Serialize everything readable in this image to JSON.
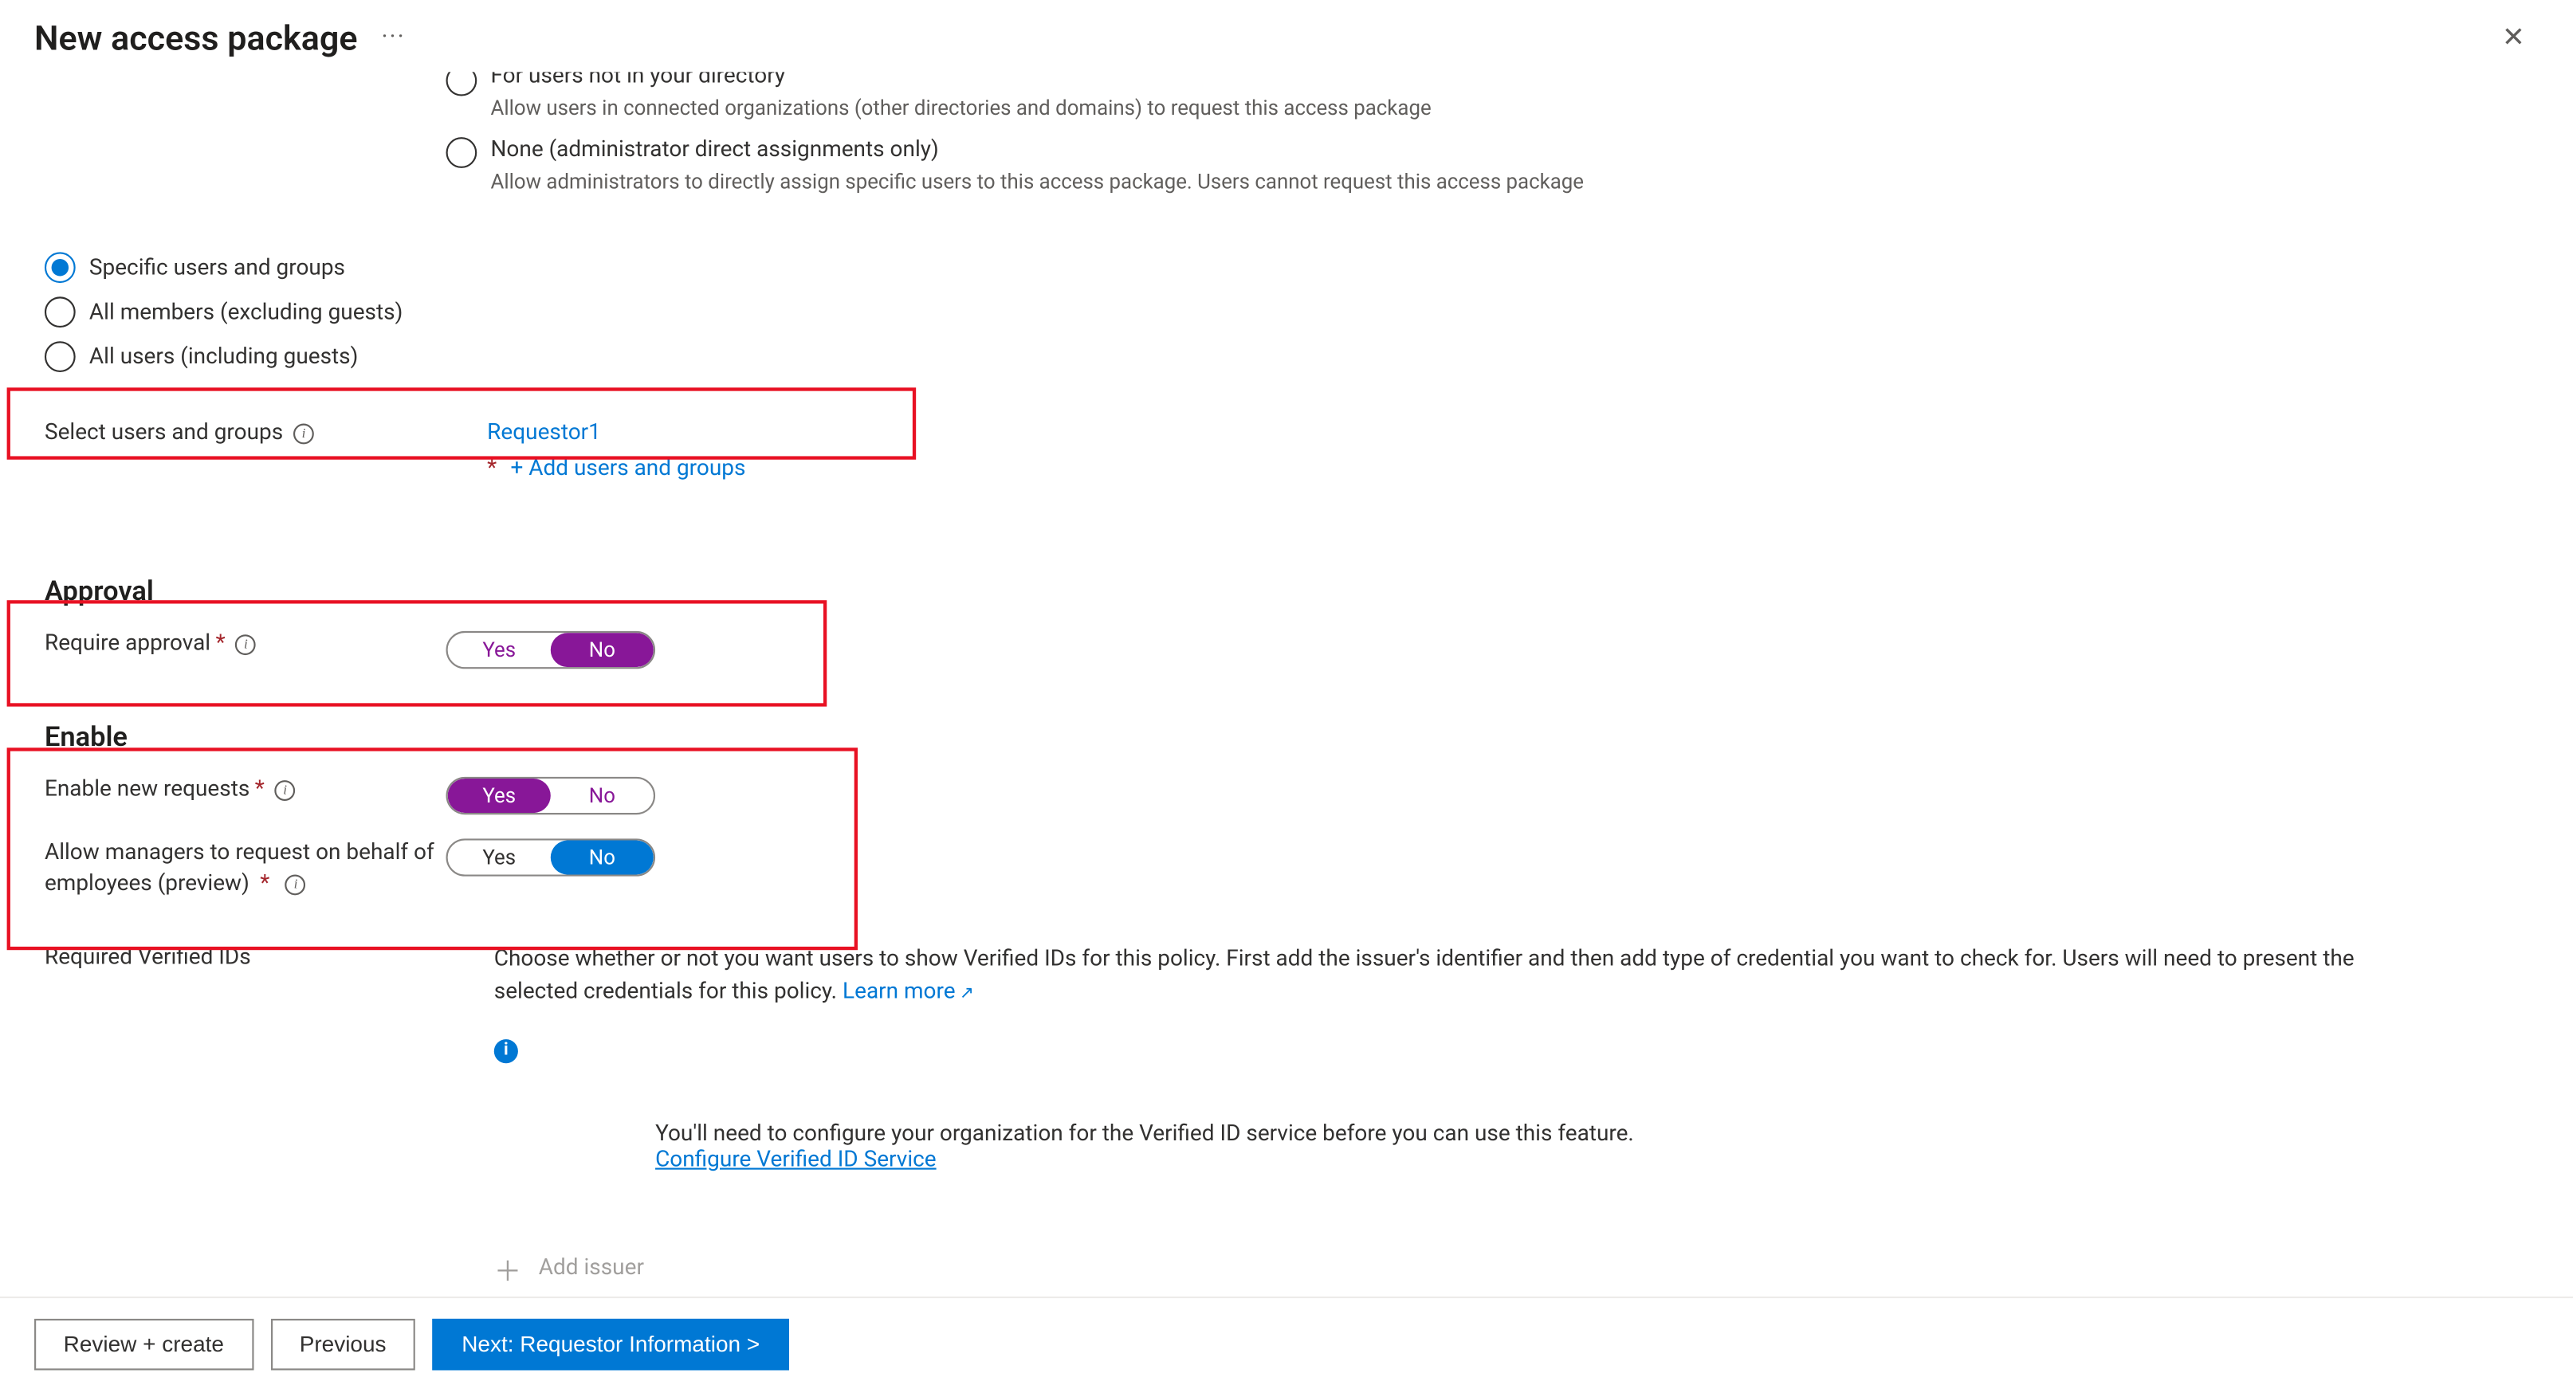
{
  "header": {
    "title": "New access package",
    "more_icon": "···",
    "close_icon": "✕"
  },
  "scope_radios_top": {
    "not_in_directory": {
      "label": "For users not in your directory",
      "desc": "Allow users in connected organizations (other directories and domains) to request this access package"
    },
    "none": {
      "label": "None (administrator direct assignments only)",
      "desc": "Allow administrators to directly assign specific users to this access package. Users cannot request this access package"
    }
  },
  "scope_radios": {
    "specific": "Specific users and groups",
    "members": "All members (excluding guests)",
    "all": "All users (including guests)"
  },
  "select_users": {
    "label": "Select users and groups",
    "value": "Requestor1",
    "add_link": "+ Add users and groups"
  },
  "approval": {
    "section_title": "Approval",
    "require_label": "Require approval",
    "yes": "Yes",
    "no": "No"
  },
  "enable": {
    "section_title": "Enable",
    "new_requests_label": "Enable new requests",
    "managers_label": "Allow managers to request on behalf of employees (preview)",
    "yes": "Yes",
    "no": "No"
  },
  "verified": {
    "label": "Required Verified IDs",
    "desc1": "Choose whether or not you want users to show Verified IDs for this policy. First add the issuer's identifier and then add type of credential you want to check for. Users will need to present the selected credentials for this policy.",
    "learn_more": "Learn more",
    "config_msg": "You'll need to configure your organization for the Verified ID service before you can use this feature.",
    "config_link": "Configure Verified ID Service",
    "add_issuer": "Add issuer"
  },
  "footer": {
    "review": "Review + create",
    "previous": "Previous",
    "next": "Next: Requestor Information >"
  }
}
